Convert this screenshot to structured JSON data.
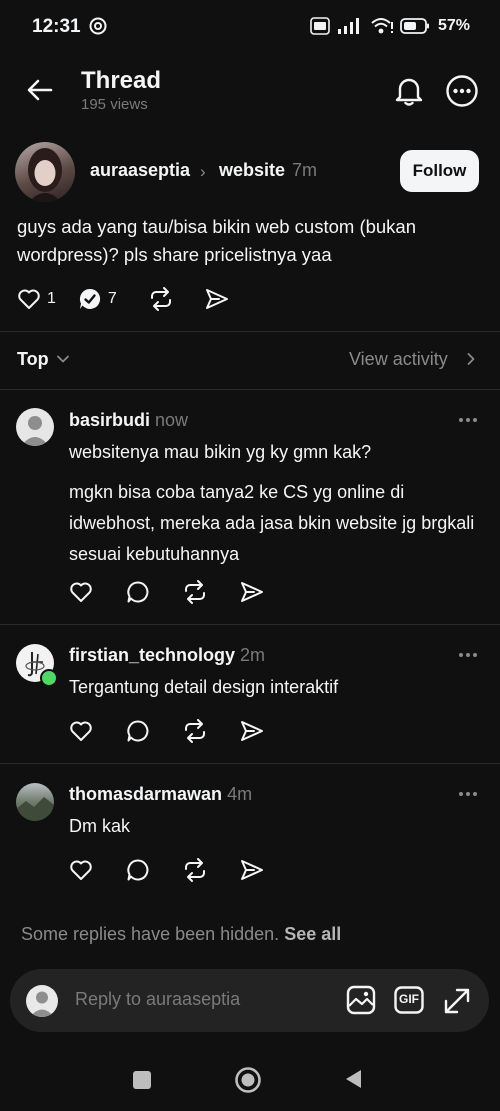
{
  "status_bar": {
    "time": "12:31",
    "battery": "57%"
  },
  "header": {
    "title": "Thread",
    "views": "195 views"
  },
  "post": {
    "author": "auraaseptia",
    "separator": "›",
    "topic": "website",
    "time": "7m",
    "follow_label": "Follow",
    "text": "guys ada yang tau/bisa bikin web custom (bukan wordpress)? pls share pricelistnya yaa",
    "likes": "1",
    "replies": "7"
  },
  "sort": {
    "label": "Top",
    "activity_label": "View activity"
  },
  "replies": [
    {
      "author": "basirbudi",
      "time": "now",
      "paragraphs": [
        "websitenya mau bikin yg ky gmn kak?",
        "mgkn bisa coba tanya2 ke CS yg online di idwebhost, mereka ada jasa bkin website jg brgkali sesuai kebutuhannya"
      ]
    },
    {
      "author": "firstian_technology",
      "time": "2m",
      "paragraphs": [
        "Tergantung detail design interaktif"
      ]
    },
    {
      "author": "thomasdarmawan",
      "time": "4m",
      "paragraphs": [
        "Dm kak"
      ]
    }
  ],
  "hidden_notice": {
    "text": "Some replies have been hidden.",
    "link": "See all"
  },
  "composer": {
    "placeholder": "Reply to auraaseptia",
    "gif_label": "GIF"
  },
  "colors": {
    "background": "#101010",
    "text": "#f3f5f7",
    "muted": "#7a7a7a",
    "composer": "#232323",
    "online": "#4cd964"
  }
}
